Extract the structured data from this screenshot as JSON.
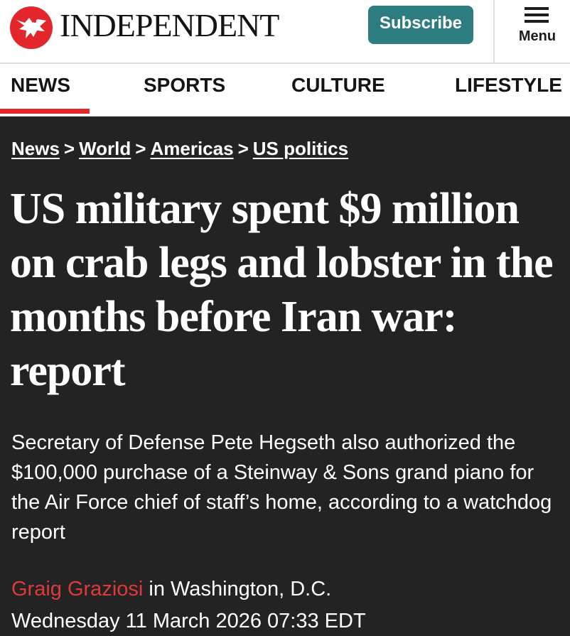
{
  "masthead": {
    "logo_text": "INDEPENDENT",
    "subscribe_label": "Subscribe",
    "menu_label": "Menu"
  },
  "nav": {
    "tabs": [
      {
        "label": "NEWS",
        "active": true
      },
      {
        "label": "SPORTS"
      },
      {
        "label": "CULTURE"
      },
      {
        "label": "LIFESTYLE"
      }
    ]
  },
  "breadcrumb": {
    "items": [
      "News",
      "World",
      "Americas",
      "US politics"
    ],
    "separator": ">"
  },
  "article": {
    "headline": "US military spent $9 million on crab legs and lobster in the months before Iran war: report",
    "standfirst": "Secretary of Defense Pete Hegseth also authorized the $100,000 purchase of a Steinway & Sons grand piano for the Air Force chief of staff’s home, according to a watchdog report",
    "author": "Graig Graziosi",
    "location": " in Washington, D.C.",
    "date": "Wednesday 11 March 2026 07:33 EDT"
  },
  "colors": {
    "brand_red": "#e3262b",
    "subscribe_teal": "#2d7d80",
    "article_background": "#232323"
  },
  "icons": [
    "eagle-logo-icon",
    "hamburger-menu-icon"
  ]
}
